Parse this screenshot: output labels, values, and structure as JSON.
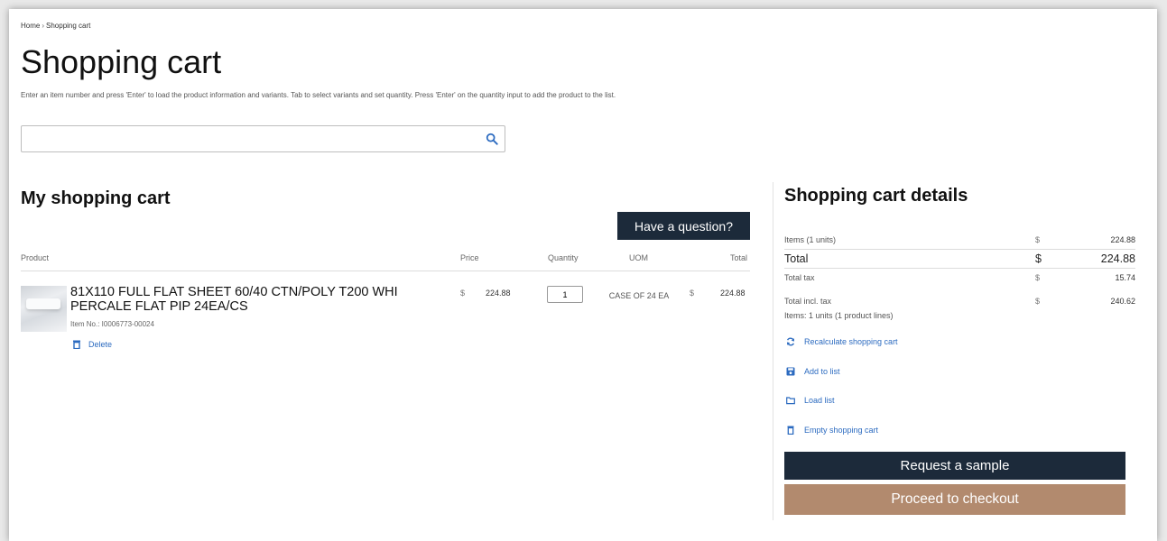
{
  "breadcrumb": {
    "home": "Home",
    "separator": "›",
    "current": "Shopping cart"
  },
  "page_title": "Shopping cart",
  "instructions": "Enter an item number and press 'Enter' to load the product information and variants. Tab to select variants and set quantity. Press 'Enter' on the quantity input to add the product to the list.",
  "search": {
    "value": "",
    "placeholder": ""
  },
  "cart": {
    "title": "My shopping cart",
    "question_button": "Have a question?",
    "columns": {
      "product": "Product",
      "price": "Price",
      "quantity": "Quantity",
      "uom": "UOM",
      "total": "Total"
    },
    "items": [
      {
        "name": "81X110 FULL FLAT SHEET 60/40 CTN/POLY T200 WHI PERCALE FLAT PIP 24EA/CS",
        "item_no": "Item No.: I0006773-00024",
        "price_currency": "$",
        "price": "224.88",
        "quantity": "1",
        "uom": "CASE OF 24 EA",
        "total_currency": "$",
        "total": "224.88",
        "delete_label": "Delete"
      }
    ]
  },
  "details": {
    "title": "Shopping cart details",
    "items_label": "Items (1 units)",
    "items_currency": "$",
    "items_value": "224.88",
    "total_label": "Total",
    "total_currency": "$",
    "total_value": "224.88",
    "tax_label": "Total tax",
    "tax_currency": "$",
    "tax_value": "15.74",
    "incl_label": "Total incl. tax",
    "incl_currency": "$",
    "incl_value": "240.62",
    "summary_note": "Items: 1 units (1 product lines)",
    "actions": {
      "recalculate": "Recalculate shopping cart",
      "add_to_list": "Add to list",
      "load_list": "Load list",
      "empty_cart": "Empty shopping cart"
    },
    "request_sample": "Request a sample",
    "checkout": "Proceed to checkout"
  },
  "colors": {
    "primary_dark": "#1c2a3a",
    "checkout": "#b28a6e",
    "link": "#2c6bc0"
  },
  "icons": {
    "search": "search-icon",
    "delete": "trash-icon",
    "recalculate": "refresh-icon",
    "add_to_list": "save-icon",
    "load_list": "folder-icon",
    "empty_cart": "trash-icon"
  }
}
